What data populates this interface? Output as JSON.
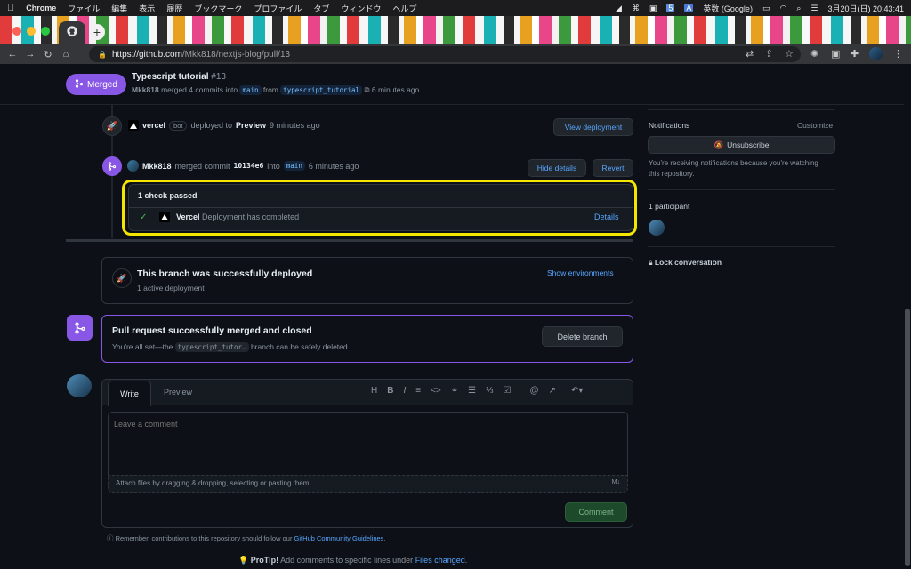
{
  "menubar": {
    "app": "Chrome",
    "items": [
      "ファイル",
      "編集",
      "表示",
      "履歴",
      "ブックマーク",
      "プロファイル",
      "タブ",
      "ウィンドウ",
      "ヘルプ"
    ],
    "input_source": "英数 (Google)",
    "datetime": "3月20日(日)  20:43:41"
  },
  "browser": {
    "url_host": "https://github.com",
    "url_path": "/Mkk818/nextjs-blog/pull/13"
  },
  "pr_header": {
    "state": "Merged",
    "title": "Typescript tutorial",
    "number": "#13",
    "author": "Mkk818",
    "merged_text": "merged 4 commits into",
    "base_branch": "main",
    "from_text": "from",
    "head_branch": "typescript_tutorial",
    "time": "6 minutes ago"
  },
  "timeline": {
    "deploy_event": {
      "actor": "vercel",
      "bot_label": "bot",
      "text": "deployed to",
      "environment": "Preview",
      "time": "9 minutes ago",
      "button": "View deployment"
    },
    "merge_event": {
      "actor": "Mkk818",
      "text": "merged commit",
      "commit": "10134e6",
      "into": "into",
      "branch": "main",
      "time": "6 minutes ago",
      "hide_button": "Hide details",
      "revert_button": "Revert"
    },
    "checks": {
      "summary": "1 check passed",
      "check_name": "Vercel",
      "check_desc": "Deployment has completed",
      "details_link": "Details"
    }
  },
  "deployed_box": {
    "title": "This branch was successfully deployed",
    "subtitle": "1 active deployment",
    "link": "Show environments"
  },
  "merged_box": {
    "title": "Pull request successfully merged and closed",
    "text_before": "You're all set—the",
    "branch": "typescript_tutor…",
    "text_after": "branch can be safely deleted.",
    "button": "Delete branch"
  },
  "comment_form": {
    "tab_write": "Write",
    "tab_preview": "Preview",
    "placeholder": "Leave a comment",
    "attach_text": "Attach files by dragging & dropping, selecting or pasting them.",
    "submit": "Comment",
    "md_badge": "M↓"
  },
  "footer": {
    "remember_text": "Remember, contributions to this repository should follow our",
    "guidelines_link": "GitHub Community Guidelines",
    "protip_label": "ProTip!",
    "protip_text": "Add comments to specific lines under",
    "protip_link": "Files changed"
  },
  "sidebar": {
    "notifications_label": "Notifications",
    "customize": "Customize",
    "unsubscribe": "Unsubscribe",
    "reason": "You're receiving notifications because you're watching this repository.",
    "participants": "1 participant",
    "lock": "Lock conversation"
  },
  "colors": {
    "merged_purple": "#8957e5",
    "link_blue": "#58a6ff",
    "highlight_yellow": "#f5e600",
    "success_green": "#238636"
  },
  "chart_data": null
}
